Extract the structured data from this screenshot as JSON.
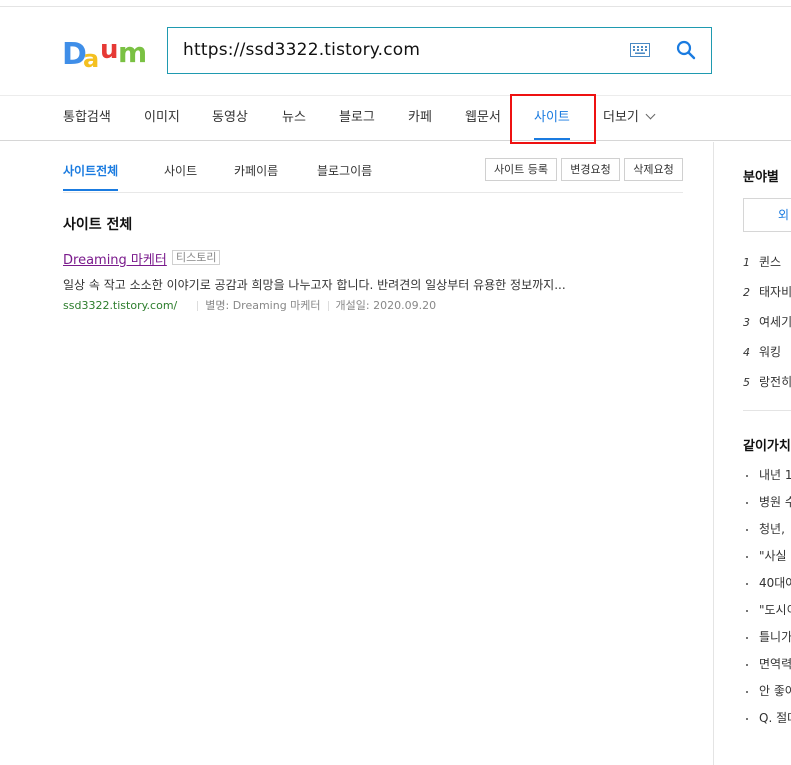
{
  "brand": {
    "logo_letters": [
      "D",
      "a",
      "u",
      "m"
    ],
    "colors": {
      "d": "#3f8ee8",
      "a": "#f4c020",
      "u": "#e63935",
      "m": "#7ac143",
      "accent": "#1a7be0",
      "search_border": "#1f9ab0"
    }
  },
  "search": {
    "query": "https://ssd3322.tistory.com"
  },
  "nav": {
    "items": [
      "통합검색",
      "이미지",
      "동영상",
      "뉴스",
      "블로그",
      "카페",
      "웹문서",
      "사이트",
      "더보기"
    ],
    "active": "사이트"
  },
  "subtabs": {
    "items": [
      "사이트전체",
      "사이트",
      "카페이름",
      "블로그이름"
    ],
    "active": "사이트전체"
  },
  "actions": {
    "register": "사이트 등록",
    "change": "변경요청",
    "delete": "삭제요청"
  },
  "results": {
    "section_title": "사이트 전체",
    "item": {
      "title": "Dreaming 마케터",
      "badge": "티스토리",
      "description": "일상 속 작고 소소한 이야기로 공감과 희망을 나누고자 합니다. 반려견의 일상부터 유용한 정보까지...",
      "url": "ssd3322.tistory.com/",
      "alias": "별명: Dreaming 마케터",
      "opened": "개설일: 2020.09.20"
    }
  },
  "sidebar": {
    "title1": "분야별",
    "tab_label": "외",
    "ranks": [
      {
        "num": "1",
        "text": "퀸스"
      },
      {
        "num": "2",
        "text": "태자비"
      },
      {
        "num": "3",
        "text": "여세기"
      },
      {
        "num": "4",
        "text": "워킹"
      },
      {
        "num": "5",
        "text": "랑전히"
      }
    ],
    "title2": "같이가치",
    "items": [
      "내년 1",
      "병원 수",
      "청년,",
      "\"사실",
      "40대여",
      "\"도시이",
      "틀니가",
      "면역력",
      "안 좋아",
      "Q. 절대"
    ]
  }
}
